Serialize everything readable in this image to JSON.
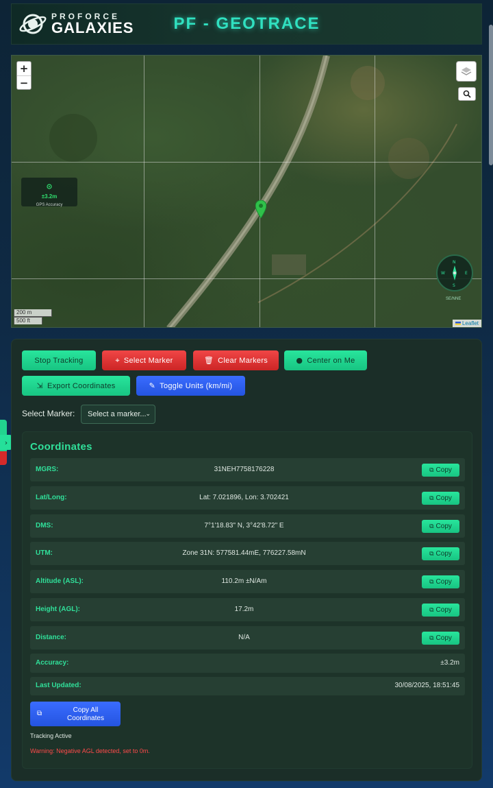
{
  "header": {
    "logo_top": "PROFORCE",
    "logo_main": "GALAXIES",
    "title": "PF - GEOTRACE"
  },
  "map": {
    "zoom_in": "+",
    "zoom_out": "−",
    "gps_accuracy_value": "±3.2m",
    "gps_accuracy_label": "GPS Accuracy",
    "compass_label": "SE/NNE",
    "scale_metric": "200 m",
    "scale_imperial": "500 ft",
    "attribution": "Leaflet"
  },
  "controls": {
    "stop_tracking": "Stop Tracking",
    "select_marker": "Select Marker",
    "clear_markers": "Clear Markers",
    "center_on_me": "Center on Me",
    "export_coordinates": "Export Coordinates",
    "toggle_units": "Toggle Units (km/mi)",
    "select_marker_label": "Select Marker:",
    "select_marker_placeholder": "Select a marker..."
  },
  "coordinates": {
    "title": "Coordinates",
    "copy_label": "Copy",
    "rows": [
      {
        "label": "MGRS:",
        "value": "31NEH7758176228"
      },
      {
        "label": "Lat/Long:",
        "value": "Lat: 7.021896, Lon: 3.702421"
      },
      {
        "label": "DMS:",
        "value": "7°1'18.83\" N, 3°42'8.72\" E"
      },
      {
        "label": "UTM:",
        "value": "Zone 31N: 577581.44mE, 776227.58mN"
      },
      {
        "label": "Altitude (ASL):",
        "value": "110.2m ±N/Am"
      },
      {
        "label": "Height (AGL):",
        "value": "17.2m"
      },
      {
        "label": "Distance:",
        "value": "N/A"
      }
    ],
    "accuracy_label": "Accuracy:",
    "accuracy_value": "±3.2m",
    "updated_label": "Last Updated:",
    "updated_value": "30/08/2025, 18:51:45",
    "copy_all": "Copy All Coordinates",
    "status": "Tracking Active",
    "warning": "Warning: Negative AGL detected, set to 0m."
  },
  "colors": {
    "accent_green": "#30e09a",
    "danger_red": "#cc2525",
    "primary_blue": "#2454e0"
  }
}
